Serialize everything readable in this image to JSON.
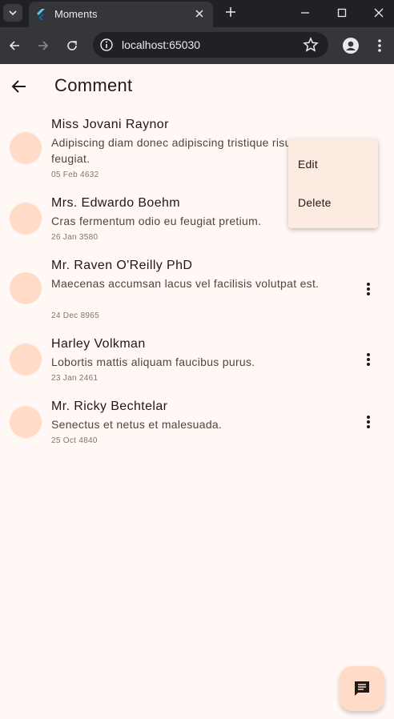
{
  "browser": {
    "tab_title": "Moments",
    "url": "localhost:65030"
  },
  "appbar": {
    "title": "Comment"
  },
  "comments": [
    {
      "name": "Miss Jovani Raynor",
      "text": "Adipiscing diam donec adipiscing tristique risus nec feugiat.",
      "date": "05 Feb 4632"
    },
    {
      "name": "Mrs. Edwardo Boehm",
      "text": "Cras fermentum odio eu feugiat pretium.",
      "date": "26 Jan 3580"
    },
    {
      "name": "Mr. Raven O'Reilly PhD",
      "text": "Maecenas accumsan lacus vel facilisis volutpat est.",
      "date": "24 Dec 8965"
    },
    {
      "name": "Harley Volkman",
      "text": "Lobortis mattis aliquam faucibus purus.",
      "date": "23 Jan 2461"
    },
    {
      "name": "Mr. Ricky Bechtelar",
      "text": "Senectus et netus et malesuada.",
      "date": "25 Oct 4840"
    }
  ],
  "popup_menu": {
    "edit_label": "Edit",
    "delete_label": "Delete"
  },
  "colors": {
    "background": "#fff8f5",
    "avatar": "#ffdbc8",
    "menu": "#fdeae0"
  }
}
